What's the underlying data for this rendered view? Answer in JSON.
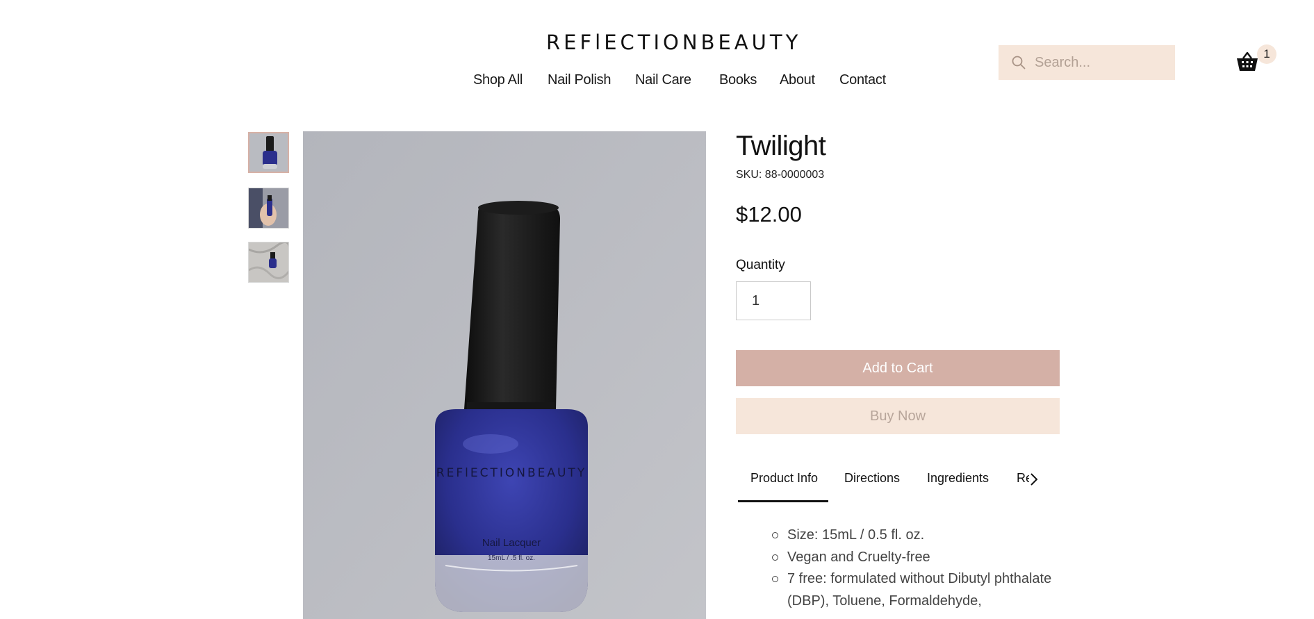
{
  "header": {
    "logo_text": "REFlECTIONBEAUTY",
    "nav": [
      {
        "label": "Shop All"
      },
      {
        "label": "Nail Polish"
      },
      {
        "label": "Nail Care"
      },
      {
        "label": "Books"
      },
      {
        "label": "About"
      },
      {
        "label": "Contact"
      }
    ],
    "search": {
      "placeholder": "Search...",
      "icon": "search-icon"
    },
    "cart": {
      "count": "1",
      "icon": "basket-icon"
    }
  },
  "gallery": {
    "thumbnails": [
      {
        "alt": "Twilight bottle",
        "active": true
      },
      {
        "alt": "Polish in hand",
        "active": false
      },
      {
        "alt": "Polish on fabric",
        "active": false
      }
    ],
    "main_image_brand": "REFlECTIONBEAUTY",
    "main_image_label": "Nail Lacquer",
    "main_image_sublabel": "15mL / .5 fl. oz."
  },
  "product": {
    "name": "Twilight",
    "sku": "SKU: 88-0000003",
    "price": "$12.00",
    "quantity_label": "Quantity",
    "quantity_value": "1",
    "add_to_cart_label": "Add to Cart",
    "buy_now_label": "Buy Now"
  },
  "tabs": [
    {
      "label": "Product Info",
      "active": true
    },
    {
      "label": "Directions",
      "active": false
    },
    {
      "label": "Ingredients",
      "active": false
    },
    {
      "label": "Re",
      "active": false
    }
  ],
  "product_info": [
    "Size: 15mL / 0.5 fl. oz.",
    "Vegan and Cruelty-free",
    "7 free: formulated without Dibutyl phthalate (DBP), Toluene, Formaldehyde,"
  ],
  "colors": {
    "accent_light": "#f6e6da",
    "accent_rose": "#d4b0a6",
    "polish_blue": "#2b2f8c"
  }
}
